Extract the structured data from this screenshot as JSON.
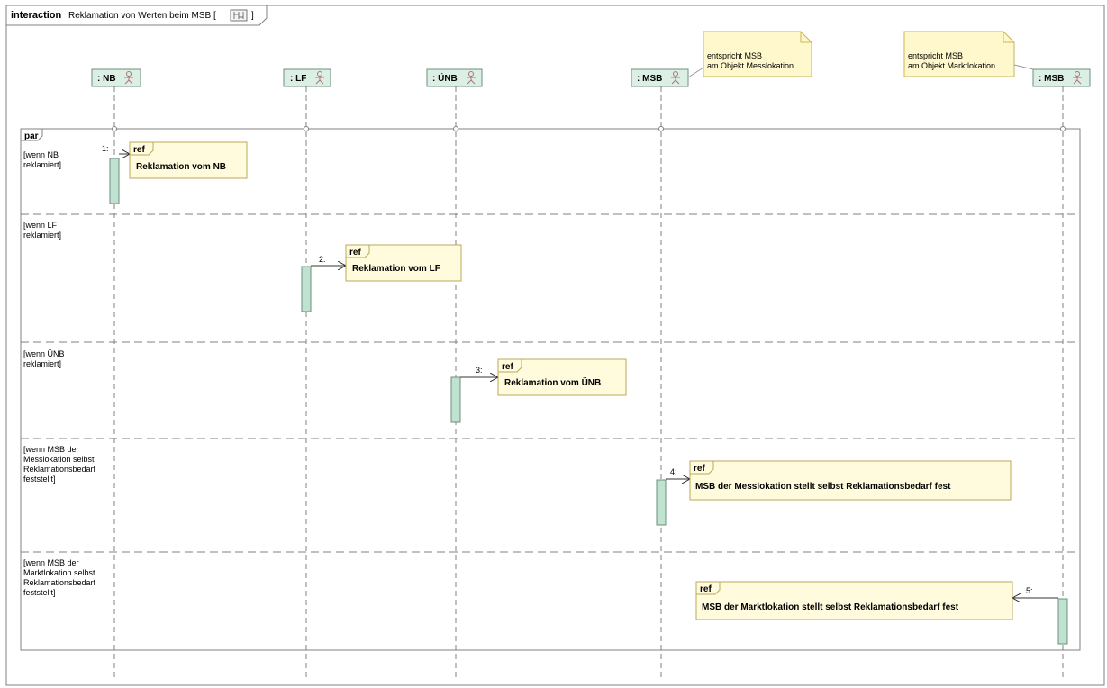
{
  "frame": {
    "keyword": "interaction",
    "title": "Reklamation von Werten beim MSB [",
    "title_suffix": "]"
  },
  "lifelines": [
    {
      "id": "nb",
      "label": ": NB"
    },
    {
      "id": "lf",
      "label": ": LF"
    },
    {
      "id": "unb",
      "label": ": ÜNB"
    },
    {
      "id": "msb1",
      "label": ": MSB"
    },
    {
      "id": "msb2",
      "label": ": MSB"
    }
  ],
  "notes": [
    {
      "lines": [
        "entspricht MSB",
        "am Objekt Messlokation"
      ]
    },
    {
      "lines": [
        "entspricht MSB",
        "am Objekt Marktlokation"
      ]
    }
  ],
  "fragment": {
    "operator": "par",
    "operands": [
      {
        "guard": [
          "[wenn NB",
          "reklamiert]"
        ]
      },
      {
        "guard": [
          "[wenn LF",
          "reklamiert]"
        ]
      },
      {
        "guard": [
          "[wenn ÜNB",
          "reklamiert]"
        ]
      },
      {
        "guard": [
          "[wenn MSB der",
          "Messlokation selbst",
          "Reklamationsbedarf",
          "feststellt]"
        ]
      },
      {
        "guard": [
          "[wenn MSB der",
          "Marktlokation selbst",
          "Reklamationsbedarf",
          "feststellt]"
        ]
      }
    ]
  },
  "refs": [
    {
      "keyword": "ref",
      "text": "Reklamation vom NB",
      "number": "1:"
    },
    {
      "keyword": "ref",
      "text": "Reklamation vom LF",
      "number": "2:"
    },
    {
      "keyword": "ref",
      "text": "Reklamation vom ÜNB",
      "number": "3:"
    },
    {
      "keyword": "ref",
      "text": "MSB der Messlokation stellt selbst Reklamationsbedarf fest",
      "number": "4:"
    },
    {
      "keyword": "ref",
      "text": "MSB der Marktlokation stellt selbst Reklamationsbedarf fest",
      "number": "5:"
    }
  ],
  "colors": {
    "lifeline_fill": "#dcefe4",
    "lifeline_stroke": "#6e8f7e",
    "activation_fill": "#bfe3d0",
    "note_fill": "#fff8cc",
    "note_stroke": "#c9b35a",
    "ref_fill": "#fffbdc",
    "ref_stroke": "#b8a85a",
    "actor_icon": "#b07070"
  }
}
